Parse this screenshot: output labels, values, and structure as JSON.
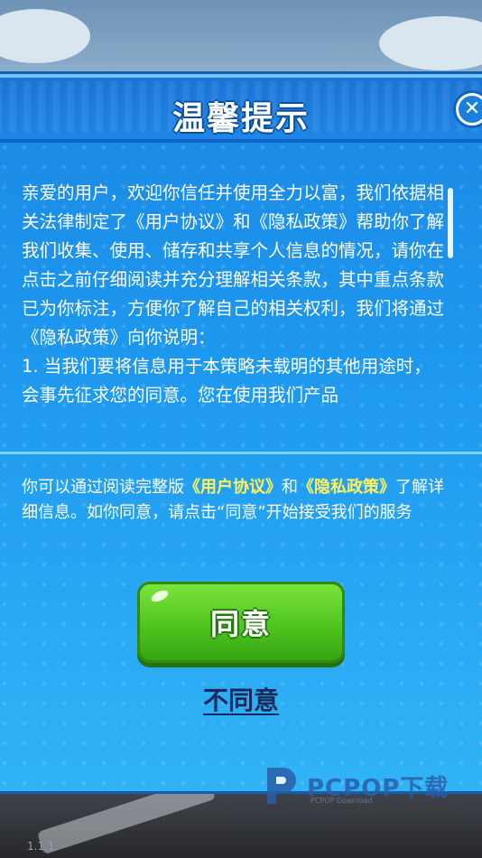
{
  "dialog": {
    "title": "温馨提示",
    "body_paragraphs": [
      "亲爱的用户，欢迎你信任并使用全力以富，我们依据相关法律制定了《用户协议》和《隐私政策》帮助你了解我们收集、使用、储存和共享个人信息的情况，请你在点击之前仔细阅读并充分理解相关条款，其中重点条款已为你标注，方便你了解自己的相关权利，我们将通过《隐私政策》向你说明：",
      "1. 当我们要将信息用于本策略未载明的其他用途时，会事先征求您的同意。您在使用我们产品"
    ],
    "notice": {
      "prefix": "你可以通过阅读完整版",
      "link_user_agreement": "《用户协议》",
      "and": "和",
      "link_privacy_policy": "《隐私政策》",
      "suffix": "了解详细信息。如你同意，请点击“同意”开始接受我们的服务"
    },
    "agree_label": "同意",
    "disagree_label": "不同意"
  },
  "footer": {
    "version": "1.1.1."
  },
  "watermark": {
    "brand": "PCPOP下载",
    "sub": "PCPOP Download"
  },
  "colors": {
    "panel_blue": "#1d98ef",
    "link_yellow": "#fff25a",
    "agree_green": "#4fc51f",
    "disagree_navy": "#1c2a59"
  },
  "icons": {
    "close": "close-icon"
  }
}
